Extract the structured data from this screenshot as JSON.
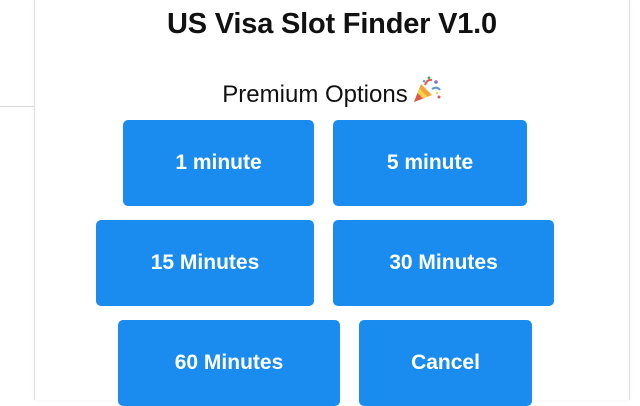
{
  "popup": {
    "title": "US Visa Slot Finder V1.0",
    "subtitle": "Premium Options",
    "subtitle_icon": "party-popper-icon"
  },
  "buttons": {
    "one_minute": "1 minute",
    "five_minute": "5 minute",
    "fifteen_minutes": "15 Minutes",
    "thirty_minutes": "30 Minutes",
    "sixty_minutes": "60 Minutes",
    "cancel": "Cancel"
  },
  "colors": {
    "button_bg": "#1a8cf0",
    "button_text": "#ffffff",
    "text": "#111111"
  }
}
